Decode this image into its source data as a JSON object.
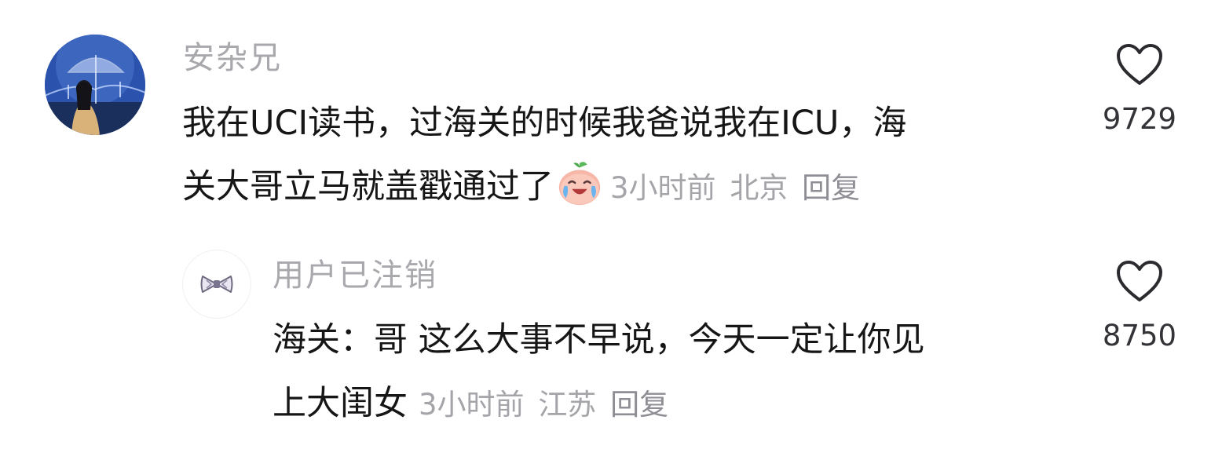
{
  "comments": [
    {
      "username": "安杂兄",
      "avatar": "avatar-girl-umbrella",
      "line1": "我在UCI读书，过海关的时候我爸说我在ICU，海",
      "line2": "关大哥立马就盖戳通过了",
      "emoji": "laughing-crying-peach-emoji",
      "time": "3小时前",
      "location": "北京",
      "reply_label": "回复",
      "like_icon": "heart-outline-icon",
      "like_count": "9729"
    },
    {
      "username": "用户已注销",
      "avatar": "avatar-bow-deleted",
      "line1": "海关：哥 这么大事不早说，今天一定让你见",
      "line2": "上大闺女",
      "time": "3小时前",
      "location": "江苏",
      "reply_label": "回复",
      "like_icon": "heart-outline-icon",
      "like_count": "8750"
    }
  ],
  "colors": {
    "text": "#161616",
    "username": "#a8a8ad",
    "meta": "#a4a4a9",
    "heart": "#2b2b2f"
  }
}
